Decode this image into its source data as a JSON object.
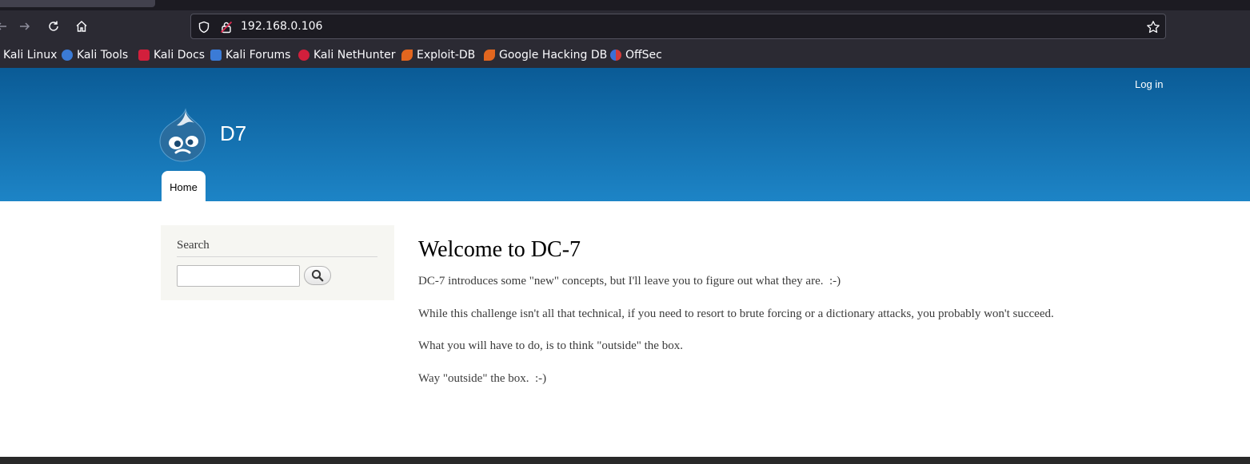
{
  "browser": {
    "url": "192.168.0.106",
    "bookmarks": [
      {
        "label": "Kali Linux",
        "icon": "kali-linux-icon",
        "color": "#2b2a33"
      },
      {
        "label": "Kali Tools",
        "icon": "kali-tools-icon",
        "color": "#3b7bd6"
      },
      {
        "label": "Kali Docs",
        "icon": "kali-docs-icon",
        "color": "#d21f3c"
      },
      {
        "label": "Kali Forums",
        "icon": "kali-forums-icon",
        "color": "#3b7bd6"
      },
      {
        "label": "Kali NetHunter",
        "icon": "kali-nethunter-icon",
        "color": "#d21f3c"
      },
      {
        "label": "Exploit-DB",
        "icon": "exploit-db-icon",
        "color": "#e2661f"
      },
      {
        "label": "Google Hacking DB",
        "icon": "google-hacking-db-icon",
        "color": "#e2661f"
      },
      {
        "label": "OffSec",
        "icon": "offsec-icon",
        "color": "#3a6fd8"
      }
    ]
  },
  "site": {
    "login_label": "Log in",
    "name": "D7",
    "nav_home": "Home",
    "header_colors": [
      "#0a5b96",
      "#1d84c6"
    ]
  },
  "sidebar": {
    "search_title": "Search",
    "search_value": ""
  },
  "content": {
    "title": "Welcome to DC-7",
    "paragraphs": [
      "DC-7 introduces some \"new\" concepts, but I'll leave you to figure out what they are.  :-)",
      "While this challenge isn't all that technical, if you need to resort to brute forcing or a dictionary attacks, you probably won't succeed.",
      "What you will have to do, is to think \"outside\" the box.",
      "Way \"outside\" the box.  :-)"
    ]
  }
}
